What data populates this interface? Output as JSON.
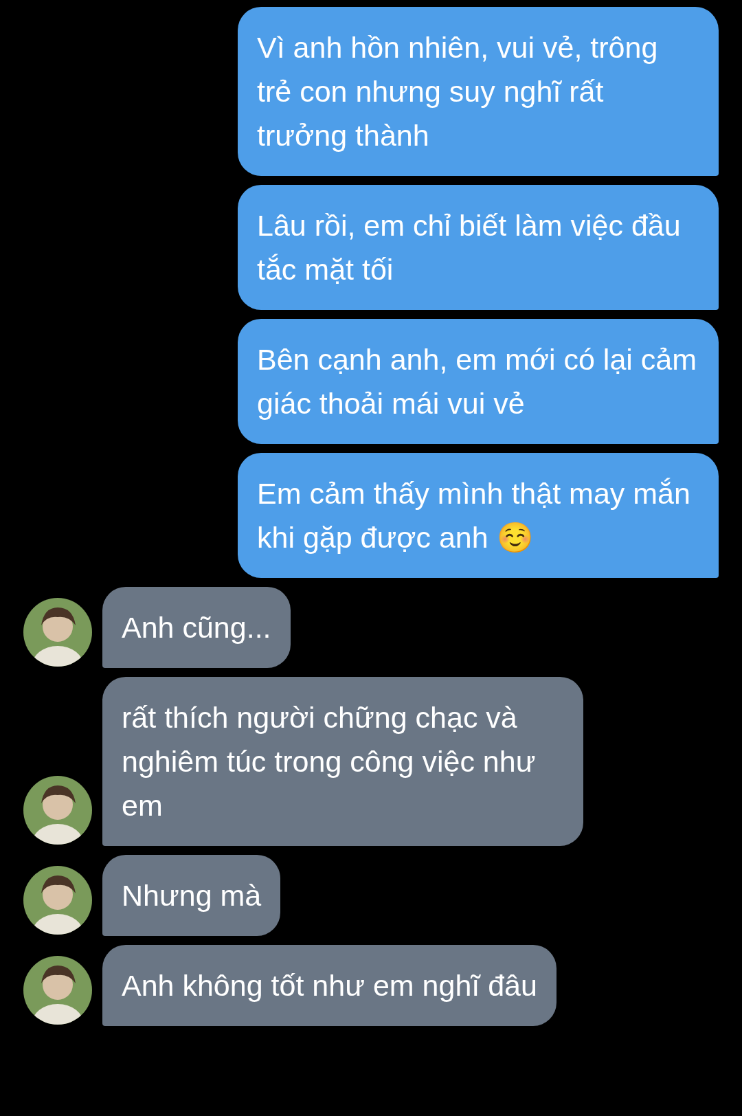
{
  "messages": [
    {
      "kind": "outgoing",
      "text": "Vì anh hồn nhiên, vui vẻ, trông trẻ con nhưng suy nghĩ rất trưởng thành"
    },
    {
      "kind": "outgoing",
      "text": "Lâu rồi, em chỉ biết làm việc đầu tắc mặt tối"
    },
    {
      "kind": "outgoing",
      "text": "Bên cạnh anh, em mới có lại cảm giác thoải mái vui vẻ"
    },
    {
      "kind": "outgoing",
      "text": "Em cảm thấy mình thật may mắn khi gặp được anh ☺️"
    },
    {
      "kind": "incoming",
      "text": "Anh cũng..."
    },
    {
      "kind": "incoming",
      "text": "rất thích người chững chạc và nghiêm túc trong công việc như em"
    },
    {
      "kind": "incoming",
      "text": "Nhưng mà"
    },
    {
      "kind": "incoming",
      "text": "Anh không tốt như em nghĩ đâu"
    }
  ]
}
